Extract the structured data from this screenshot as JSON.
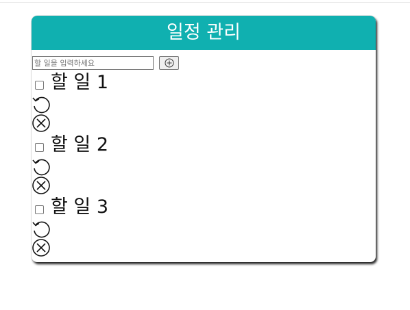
{
  "app": {
    "title": "일정 관리"
  },
  "input": {
    "placeholder": "할 일을 입력하세요",
    "value": "",
    "add_icon": "circle-plus-icon",
    "add_label": "⊕"
  },
  "todos": [
    {
      "text": "할 일 1",
      "checked": false,
      "undo_icon": "undo-icon",
      "delete_icon": "circle-x-icon"
    },
    {
      "text": "할 일 2",
      "checked": false,
      "undo_icon": "undo-icon",
      "delete_icon": "circle-x-icon"
    },
    {
      "text": "할 일 3",
      "checked": false,
      "undo_icon": "undo-icon",
      "delete_icon": "circle-x-icon"
    }
  ],
  "colors": {
    "header_bg": "#10b0b0",
    "header_text": "#ffffff"
  }
}
